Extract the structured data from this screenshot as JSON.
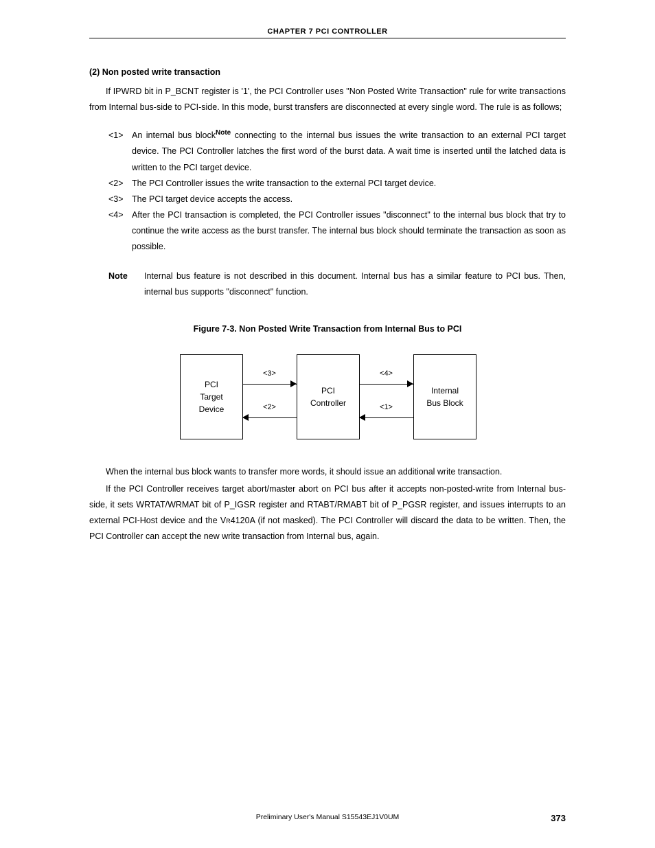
{
  "header": {
    "chapter": "CHAPTER  7   PCI CONTROLLER"
  },
  "section": {
    "title": "(2)  Non posted write transaction"
  },
  "para1": "If IPWRD bit in P_BCNT register is '1', the PCI Controller uses \"Non Posted Write Transaction\" rule for write transactions from Internal bus-side to PCI-side. In this mode, burst transfers are disconnected at every single word. The rule is as follows;",
  "list": {
    "items": [
      {
        "marker": "<1>",
        "pre": "An internal bus block",
        "sup": "Note",
        "post": " connecting to the internal bus issues the write transaction to an external PCI target device. The PCI Controller latches the first word of the burst data. A wait time is inserted until the latched data is written to the PCI target device."
      },
      {
        "marker": "<2>",
        "text": "The PCI Controller issues the write transaction to the external PCI target device."
      },
      {
        "marker": "<3>",
        "text": "The PCI target device accepts the access."
      },
      {
        "marker": "<4>",
        "text": "After the PCI transaction is completed, the PCI Controller issues \"disconnect\" to the internal bus block that try to continue the write access as the burst transfer. The internal bus block should terminate the transaction as soon as possible."
      }
    ]
  },
  "note": {
    "label": "Note",
    "text": "Internal bus feature is not described in this document. Internal bus has a similar feature to PCI bus. Then, internal bus supports \"disconnect\" function."
  },
  "figure": {
    "caption": "Figure 7-3.  Non Posted Write Transaction from Internal Bus to PCI",
    "box1_l1": "PCI",
    "box1_l2": "Target",
    "box1_l3": "Device",
    "box2_l1": "PCI",
    "box2_l2": "Controller",
    "box3_l1": "Internal",
    "box3_l2": "Bus Block",
    "arrow_3": "<3>",
    "arrow_2": "<2>",
    "arrow_4": "<4>",
    "arrow_1": "<1>"
  },
  "para2": "When the internal bus block wants to transfer more words, it should issue an additional write transaction.",
  "para3_a": "If the PCI Controller receives target abort/master abort on PCI bus after it accepts non-posted-write from Internal bus-side, it sets WRTAT/WRMAT bit of P_IGSR register and RTABT/RMABT bit of P_PGSR register, and issues interrupts to an external PCI-Host device and the V",
  "para3_sub": "R",
  "para3_b": "4120A (if not masked). The PCI Controller will discard the data to be written. Then, the PCI Controller can accept the new write transaction from Internal bus, again.",
  "footer": {
    "center": "Preliminary User's Manual  S15543EJ1V0UM",
    "page": "373"
  }
}
